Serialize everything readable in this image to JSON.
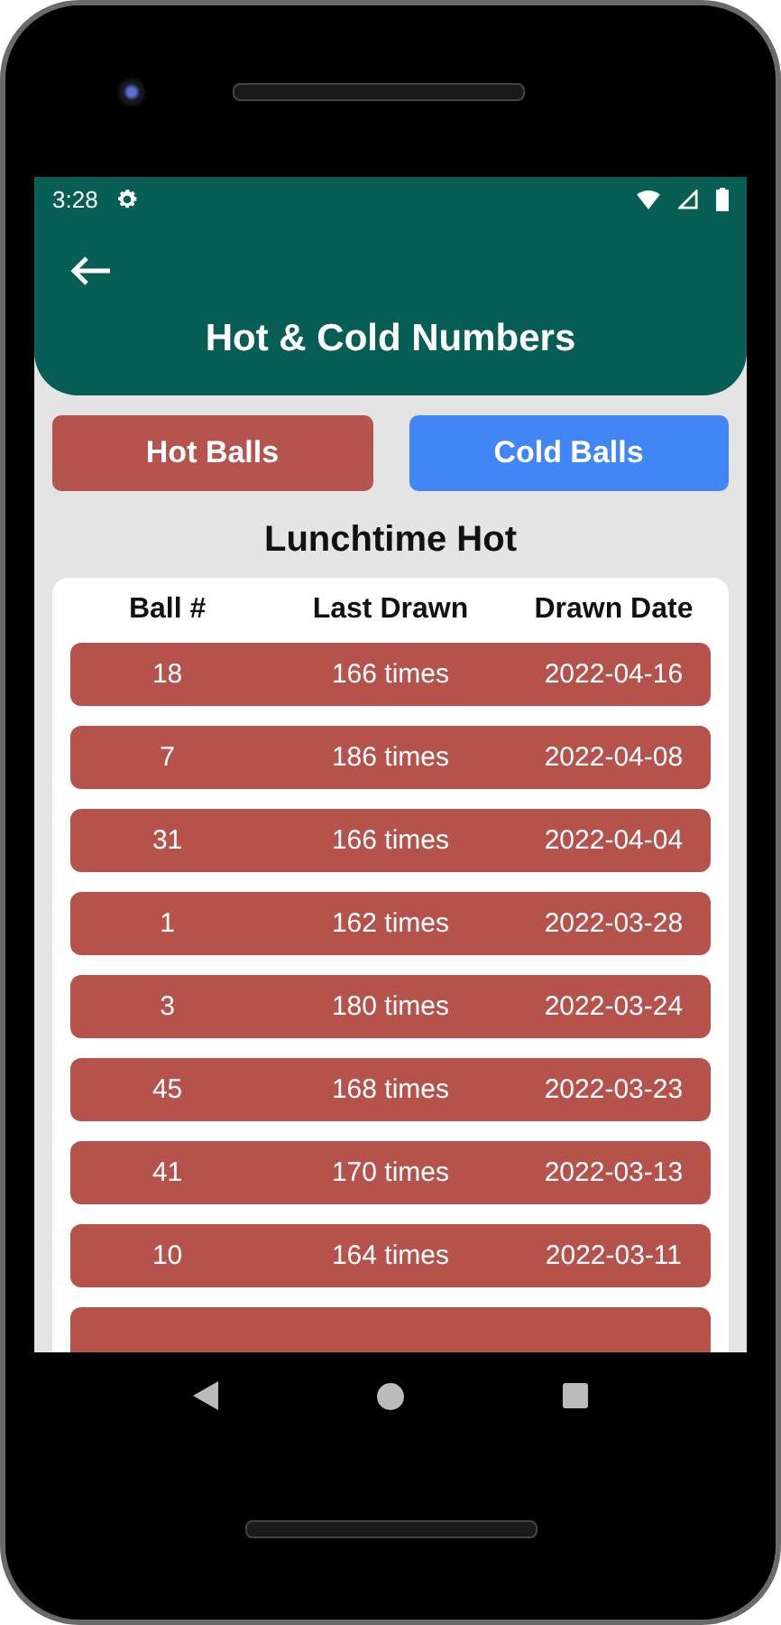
{
  "status_bar": {
    "time": "3:28"
  },
  "app_bar": {
    "title": "Hot & Cold Numbers"
  },
  "buttons": [
    {
      "label": "Hot Balls",
      "kind": "hot"
    },
    {
      "label": "Cold Balls",
      "kind": "cold"
    }
  ],
  "heading": "Lunchtime Hot",
  "table": {
    "columns": [
      "Ball #",
      "Last Drawn",
      "Drawn Date"
    ],
    "rows": [
      {
        "kind": "full",
        "cells": [
          "18",
          "166 times",
          "2022-04-16"
        ]
      },
      {
        "kind": "full",
        "cells": [
          "7",
          "186 times",
          "2022-04-08"
        ]
      },
      {
        "kind": "full",
        "cells": [
          "31",
          "166 times",
          "2022-04-04"
        ]
      },
      {
        "kind": "full",
        "cells": [
          "1",
          "162 times",
          "2022-03-28"
        ]
      },
      {
        "kind": "full",
        "cells": [
          "3",
          "180 times",
          "2022-03-24"
        ]
      },
      {
        "kind": "full",
        "cells": [
          "45",
          "168 times",
          "2022-03-23"
        ]
      },
      {
        "kind": "full",
        "cells": [
          "41",
          "170 times",
          "2022-03-13"
        ]
      },
      {
        "kind": "full",
        "cells": [
          "10",
          "164 times",
          "2022-03-11"
        ]
      },
      {
        "kind": "cut",
        "cells": []
      }
    ]
  }
}
